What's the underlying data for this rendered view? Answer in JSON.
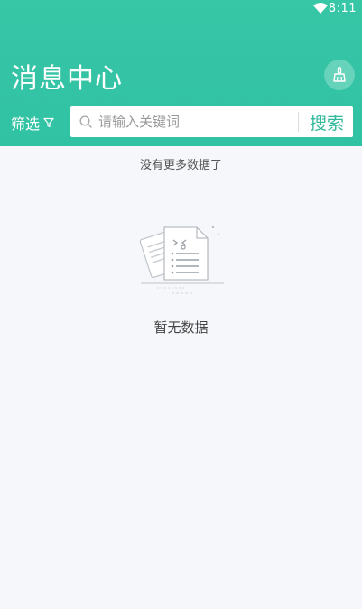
{
  "status_bar": {
    "time": "8:11"
  },
  "header": {
    "title": "消息中心",
    "filter_label": "筛选",
    "search_placeholder": "请输入关键词",
    "search_button": "搜索"
  },
  "list": {
    "end_message": "没有更多数据了",
    "empty_message": "暂无数据"
  },
  "colors": {
    "header_bg": "#34c4a5",
    "accent": "#2fb89a",
    "page_bg": "#f6f7fb"
  }
}
